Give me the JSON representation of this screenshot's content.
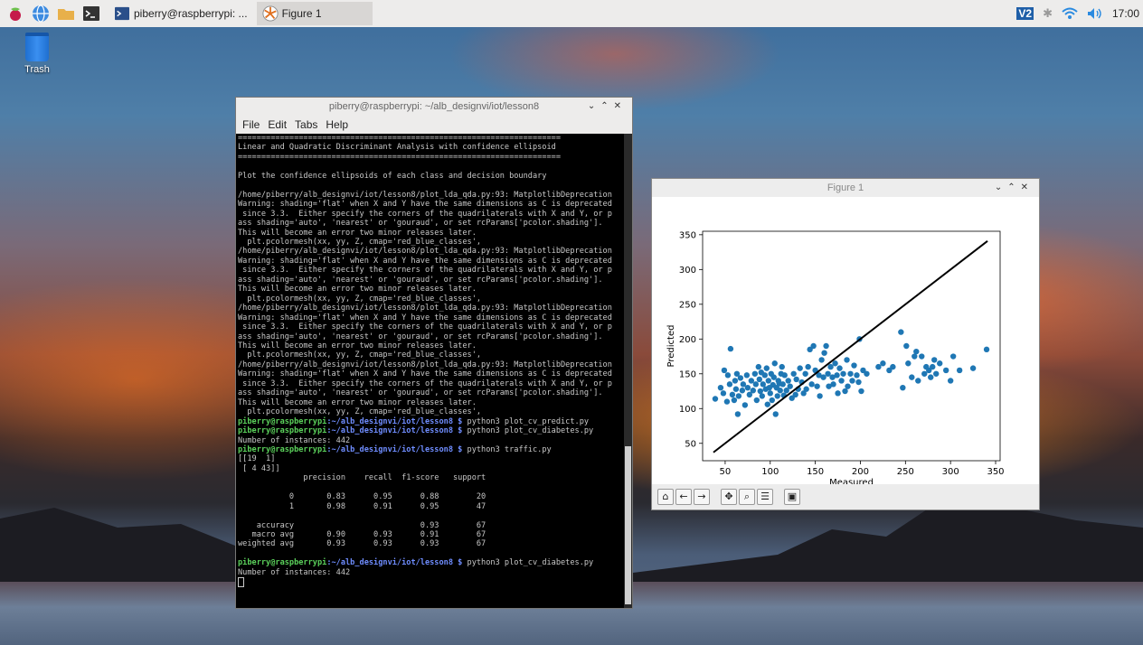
{
  "taskbar": {
    "tasks": [
      {
        "label": "piberry@raspberrypi: ..."
      },
      {
        "label": "Figure 1"
      }
    ],
    "clock": "17:00",
    "vnc_label": "V2"
  },
  "desktop": {
    "trash_label": "Trash"
  },
  "terminal": {
    "title": "piberry@raspberrypi: ~/alb_designvi/iot/lesson8",
    "menu": [
      "File",
      "Edit",
      "Tabs",
      "Help"
    ],
    "prompt_user": "piberry@raspberrypi",
    "prompt_path": ":~/alb_designvi/iot/lesson8 $",
    "lines": [
      "=====================================================================",
      "Linear and Quadratic Discriminant Analysis with confidence ellipsoid",
      "=====================================================================",
      "",
      "Plot the confidence ellipsoids of each class and decision boundary",
      "",
      "/home/piberry/alb_designvi/iot/lesson8/plot_lda_qda.py:93: MatplotlibDeprecation",
      "Warning: shading='flat' when X and Y have the same dimensions as C is deprecated",
      " since 3.3.  Either specify the corners of the quadrilaterals with X and Y, or p",
      "ass shading='auto', 'nearest' or 'gouraud', or set rcParams['pcolor.shading'].",
      "This will become an error two minor releases later.",
      "  plt.pcolormesh(xx, yy, Z, cmap='red_blue_classes',",
      "/home/piberry/alb_designvi/iot/lesson8/plot_lda_qda.py:93: MatplotlibDeprecation",
      "Warning: shading='flat' when X and Y have the same dimensions as C is deprecated",
      " since 3.3.  Either specify the corners of the quadrilaterals with X and Y, or p",
      "ass shading='auto', 'nearest' or 'gouraud', or set rcParams['pcolor.shading'].",
      "This will become an error two minor releases later.",
      "  plt.pcolormesh(xx, yy, Z, cmap='red_blue_classes',",
      "/home/piberry/alb_designvi/iot/lesson8/plot_lda_qda.py:93: MatplotlibDeprecation",
      "Warning: shading='flat' when X and Y have the same dimensions as C is deprecated",
      " since 3.3.  Either specify the corners of the quadrilaterals with X and Y, or p",
      "ass shading='auto', 'nearest' or 'gouraud', or set rcParams['pcolor.shading'].",
      "This will become an error two minor releases later.",
      "  plt.pcolormesh(xx, yy, Z, cmap='red_blue_classes',",
      "/home/piberry/alb_designvi/iot/lesson8/plot_lda_qda.py:93: MatplotlibDeprecation",
      "Warning: shading='flat' when X and Y have the same dimensions as C is deprecated",
      " since 3.3.  Either specify the corners of the quadrilaterals with X and Y, or p",
      "ass shading='auto', 'nearest' or 'gouraud', or set rcParams['pcolor.shading'].",
      "This will become an error two minor releases later.",
      "  plt.pcolormesh(xx, yy, Z, cmap='red_blue_classes',",
      "@@ python3 plot_cv_predict.py",
      "@@ python3 plot_cv_diabetes.py",
      "Number of instances: 442",
      "@@ python3 traffic.py",
      "[[19  1]",
      " [ 4 43]]",
      "              precision    recall  f1-score   support",
      "",
      "           0       0.83      0.95      0.88        20",
      "           1       0.98      0.91      0.95        47",
      "",
      "    accuracy                           0.93        67",
      "   macro avg       0.90      0.93      0.91        67",
      "weighted avg       0.93      0.93      0.93        67",
      "",
      "@@ python3 plot_cv_diabetes.py",
      "Number of instances: 442",
      ""
    ]
  },
  "figure": {
    "title": "Figure 1",
    "toolbar": [
      "home-icon",
      "back-icon",
      "forward-icon",
      "pan-icon",
      "zoom-icon",
      "configure-icon",
      "save-icon"
    ]
  },
  "chart_data": {
    "type": "scatter",
    "xlabel": "Measured",
    "ylabel": "Predicted",
    "xlim": [
      25,
      355
    ],
    "ylim": [
      25,
      355
    ],
    "xticks": [
      50,
      100,
      150,
      200,
      250,
      300,
      350
    ],
    "yticks": [
      50,
      100,
      150,
      200,
      250,
      300,
      350
    ],
    "point_color": "#1f77b4",
    "line": {
      "x": [
        37,
        341
      ],
      "y": [
        37,
        341
      ],
      "color": "#000000"
    },
    "points": [
      [
        39,
        114
      ],
      [
        45,
        130
      ],
      [
        48,
        122
      ],
      [
        49,
        155
      ],
      [
        52,
        110
      ],
      [
        53,
        148
      ],
      [
        55,
        135
      ],
      [
        56,
        186
      ],
      [
        58,
        120
      ],
      [
        60,
        112
      ],
      [
        61,
        140
      ],
      [
        62,
        128
      ],
      [
        63,
        150
      ],
      [
        64,
        92
      ],
      [
        65,
        118
      ],
      [
        67,
        144
      ],
      [
        69,
        126
      ],
      [
        70,
        135
      ],
      [
        72,
        105
      ],
      [
        74,
        148
      ],
      [
        75,
        130
      ],
      [
        77,
        120
      ],
      [
        79,
        140
      ],
      [
        81,
        126
      ],
      [
        83,
        150
      ],
      [
        84,
        135
      ],
      [
        85,
        112
      ],
      [
        87,
        160
      ],
      [
        88,
        142
      ],
      [
        89,
        125
      ],
      [
        90,
        152
      ],
      [
        91,
        118
      ],
      [
        92,
        135
      ],
      [
        94,
        148
      ],
      [
        95,
        128
      ],
      [
        96,
        158
      ],
      [
        97,
        106
      ],
      [
        98,
        140
      ],
      [
        99,
        130
      ],
      [
        100,
        122
      ],
      [
        101,
        150
      ],
      [
        102,
        112
      ],
      [
        103,
        134
      ],
      [
        104,
        145
      ],
      [
        105,
        165
      ],
      [
        106,
        92
      ],
      [
        107,
        130
      ],
      [
        108,
        118
      ],
      [
        109,
        140
      ],
      [
        110,
        136
      ],
      [
        111,
        126
      ],
      [
        112,
        150
      ],
      [
        113,
        160
      ],
      [
        114,
        135
      ],
      [
        115,
        119
      ],
      [
        116,
        148
      ],
      [
        118,
        126
      ],
      [
        120,
        140
      ],
      [
        122,
        132
      ],
      [
        124,
        115
      ],
      [
        126,
        150
      ],
      [
        128,
        120
      ],
      [
        129,
        142
      ],
      [
        131,
        128
      ],
      [
        133,
        158
      ],
      [
        135,
        138
      ],
      [
        137,
        122
      ],
      [
        139,
        150
      ],
      [
        140,
        128
      ],
      [
        142,
        160
      ],
      [
        144,
        185
      ],
      [
        146,
        135
      ],
      [
        148,
        190
      ],
      [
        150,
        155
      ],
      [
        152,
        132
      ],
      [
        154,
        148
      ],
      [
        155,
        118
      ],
      [
        157,
        170
      ],
      [
        159,
        145
      ],
      [
        160,
        180
      ],
      [
        162,
        190
      ],
      [
        164,
        150
      ],
      [
        165,
        132
      ],
      [
        167,
        160
      ],
      [
        169,
        145
      ],
      [
        170,
        135
      ],
      [
        172,
        165
      ],
      [
        174,
        148
      ],
      [
        175,
        122
      ],
      [
        177,
        158
      ],
      [
        179,
        140
      ],
      [
        181,
        150
      ],
      [
        183,
        125
      ],
      [
        185,
        170
      ],
      [
        186,
        132
      ],
      [
        189,
        150
      ],
      [
        191,
        140
      ],
      [
        193,
        162
      ],
      [
        196,
        148
      ],
      [
        198,
        138
      ],
      [
        199,
        200
      ],
      [
        201,
        125
      ],
      [
        203,
        155
      ],
      [
        207,
        150
      ],
      [
        220,
        160
      ],
      [
        225,
        165
      ],
      [
        232,
        155
      ],
      [
        236,
        160
      ],
      [
        245,
        210
      ],
      [
        247,
        130
      ],
      [
        251,
        190
      ],
      [
        253,
        165
      ],
      [
        257,
        145
      ],
      [
        260,
        175
      ],
      [
        262,
        182
      ],
      [
        264,
        140
      ],
      [
        268,
        175
      ],
      [
        271,
        150
      ],
      [
        273,
        160
      ],
      [
        276,
        155
      ],
      [
        278,
        145
      ],
      [
        280,
        160
      ],
      [
        282,
        170
      ],
      [
        284,
        150
      ],
      [
        288,
        165
      ],
      [
        295,
        155
      ],
      [
        300,
        140
      ],
      [
        303,
        175
      ],
      [
        310,
        155
      ],
      [
        325,
        158
      ],
      [
        340,
        185
      ]
    ]
  }
}
